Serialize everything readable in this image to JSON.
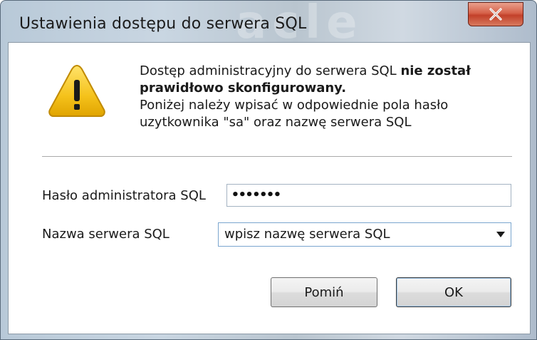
{
  "window": {
    "title": "Ustawienia dostępu do serwera SQL",
    "background_ghost_text": "acle"
  },
  "message": {
    "line1_prefix": "Dostęp administracyjny do serwera SQL ",
    "line1_bold": "nie został",
    "line2_bold": "prawidłowo skonfigurowany.",
    "line3": "Poniżej należy wpisać w odpowiednie pola hasło",
    "line4": "uzytkownika \"sa\" oraz nazwę serwera SQL"
  },
  "form": {
    "password_label": "Hasło administratora SQL",
    "password_value": "•••••••",
    "server_label": "Nazwa serwera SQL",
    "server_value": "wpisz nazwę serwera SQL"
  },
  "buttons": {
    "skip": "Pomiń",
    "ok": "OK"
  },
  "icons": {
    "close": "close-icon",
    "warning": "warning-icon",
    "dropdown": "chevron-down-icon"
  },
  "colors": {
    "close_button": "#c2402a",
    "warning_yellow": "#f5c21b",
    "focus_border": "#7aa6cf"
  }
}
